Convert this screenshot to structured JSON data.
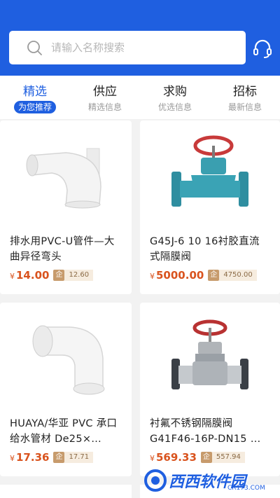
{
  "search": {
    "placeholder": "请输入名称搜索"
  },
  "tabs": [
    {
      "title": "精选",
      "subtitle": "为您推荐"
    },
    {
      "title": "供应",
      "subtitle": "精选信息"
    },
    {
      "title": "求购",
      "subtitle": "优选信息"
    },
    {
      "title": "招标",
      "subtitle": "最新信息"
    }
  ],
  "products": [
    {
      "title": "排水用PVC-U管件—大曲异径弯头",
      "currency": "¥",
      "price": "14.00",
      "ent_label": "企",
      "ent_price": "12.60",
      "icon": "pvc-elbow"
    },
    {
      "title": "G45J-6 10 16衬胶直流式隔膜阀",
      "currency": "¥",
      "price": "5000.00",
      "ent_label": "企",
      "ent_price": "4750.00",
      "icon": "diaphragm-valve"
    },
    {
      "title": "HUAYA/华亚 PVC 承口给水管材 De25×…",
      "currency": "¥",
      "price": "17.36",
      "ent_label": "企",
      "ent_price": "17.71",
      "icon": "pvc-elbow-90"
    },
    {
      "title": "衬氟不锈钢隔膜阀 G41F46-16P-DN15 …",
      "currency": "¥",
      "price": "569.33",
      "ent_label": "企",
      "ent_price": "557.94",
      "icon": "stainless-valve"
    }
  ],
  "watermark": {
    "text": "西西软件园",
    "url": "CR173.COM"
  },
  "colors": {
    "brand": "#1f5fe0",
    "price": "#d9531e",
    "ent_badge": "#c79b6c"
  }
}
